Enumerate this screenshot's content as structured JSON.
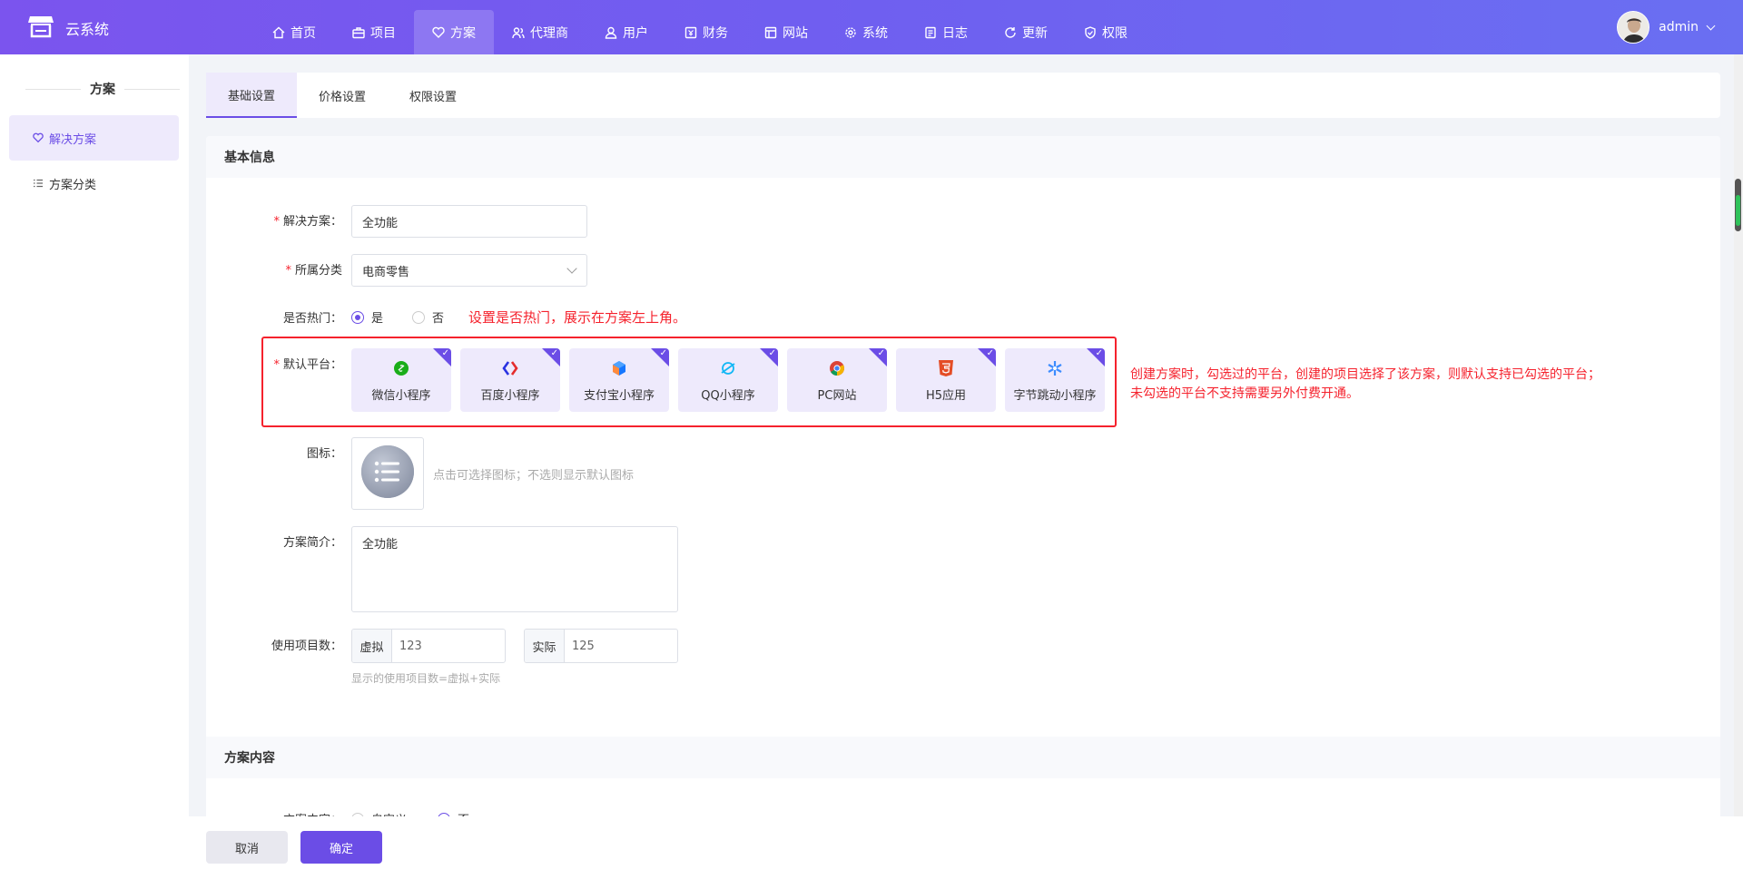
{
  "app": {
    "name": "云系统"
  },
  "nav": [
    {
      "label": "首页",
      "icon": "home-icon"
    },
    {
      "label": "项目",
      "icon": "briefcase-icon"
    },
    {
      "label": "方案",
      "icon": "heart-icon",
      "active": true
    },
    {
      "label": "代理商",
      "icon": "user-group-icon"
    },
    {
      "label": "用户",
      "icon": "user-icon"
    },
    {
      "label": "财务",
      "icon": "finance-icon"
    },
    {
      "label": "网站",
      "icon": "website-icon"
    },
    {
      "label": "系统",
      "icon": "gear-icon"
    },
    {
      "label": "日志",
      "icon": "log-icon"
    },
    {
      "label": "更新",
      "icon": "refresh-icon"
    },
    {
      "label": "权限",
      "icon": "shield-icon"
    }
  ],
  "user": {
    "name": "admin"
  },
  "sidebar": {
    "title": "方案",
    "items": [
      {
        "label": "解决方案",
        "icon": "heart-icon",
        "active": true
      },
      {
        "label": "方案分类",
        "icon": "list-icon"
      }
    ]
  },
  "tabs": [
    {
      "label": "基础设置",
      "active": true
    },
    {
      "label": "价格设置"
    },
    {
      "label": "权限设置"
    }
  ],
  "section_basic": {
    "title": "基本信息"
  },
  "form": {
    "solution": {
      "label": "解决方案：",
      "value": "全功能"
    },
    "category": {
      "label": "所属分类",
      "value": "电商零售"
    },
    "hot": {
      "label": "是否热门：",
      "yes": "是",
      "no": "否",
      "note": "设置是否热门，展示在方案左上角。"
    },
    "platforms": {
      "label": "默认平台：",
      "items": [
        {
          "label": "微信小程序",
          "icon": "wechat-icon",
          "color": "#1aad19"
        },
        {
          "label": "百度小程序",
          "icon": "baidu-icon",
          "color": "#2932e1"
        },
        {
          "label": "支付宝小程序",
          "icon": "alipay-icon",
          "color": "#1677ff"
        },
        {
          "label": "QQ小程序",
          "icon": "qq-icon",
          "color": "#12b7f5"
        },
        {
          "label": "PC网站",
          "icon": "chrome-icon",
          "color": "#4285f4"
        },
        {
          "label": "H5应用",
          "icon": "html5-icon",
          "color": "#e44d26"
        },
        {
          "label": "字节跳动小程序",
          "icon": "bytedance-icon",
          "color": "#3c8cff"
        }
      ],
      "note_line1": "创建方案时，勾选过的平台，创建的项目选择了该方案，则默认支持已勾选的平台；",
      "note_line2": "未勾选的平台不支持需要另外付费开通。"
    },
    "icon": {
      "label": "图标：",
      "hint": "点击可选择图标；不选则显示默认图标"
    },
    "intro": {
      "label": "方案简介：",
      "value": "全功能"
    },
    "usage": {
      "label": "使用项目数：",
      "virtual_label": "虚拟",
      "virtual_value": "123",
      "actual_label": "实际",
      "actual_value": "125",
      "hint": "显示的使用项目数=虚拟+实际"
    }
  },
  "section_content": {
    "title": "方案内容"
  },
  "peek": {
    "label": "方案内容：",
    "opt1": "自定义",
    "opt2": "否"
  },
  "buttons": {
    "cancel": "取消",
    "ok": "确定"
  },
  "colors": {
    "accent": "#6b4de6",
    "note": "#f5222d"
  }
}
